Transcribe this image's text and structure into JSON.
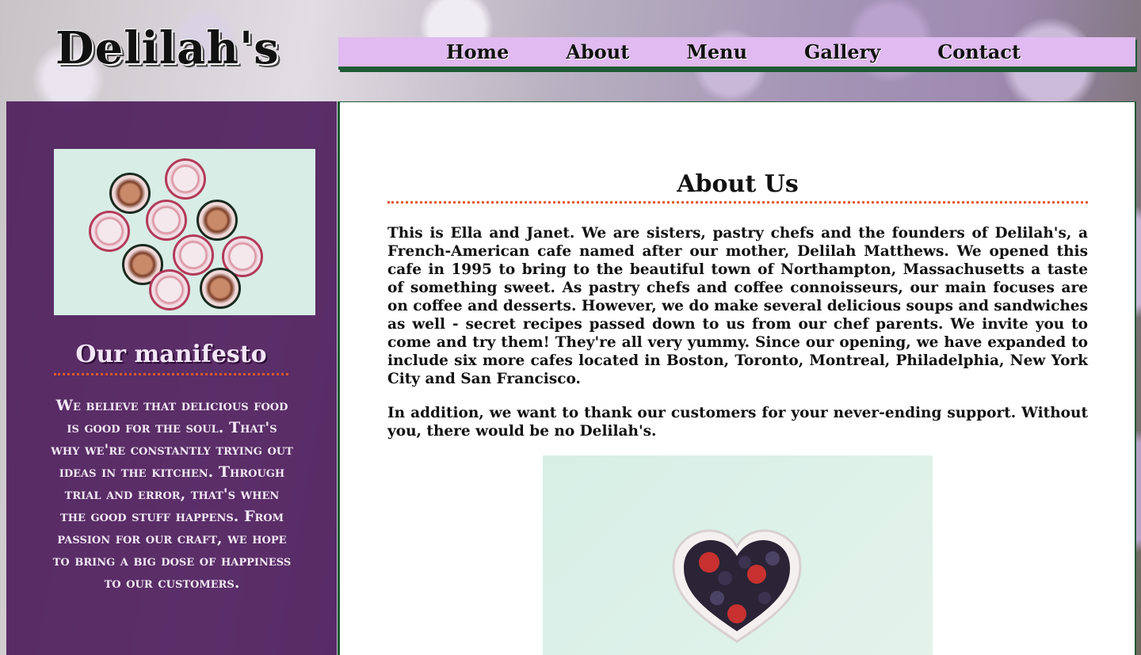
{
  "header": {
    "site_title": "Delilah's"
  },
  "nav": {
    "items": [
      {
        "label": "Home"
      },
      {
        "label": "About"
      },
      {
        "label": "Menu"
      },
      {
        "label": "Gallery"
      },
      {
        "label": "Contact"
      }
    ]
  },
  "sidebar": {
    "manifesto_title": "Our manifesto",
    "manifesto_text": "We believe that delicious food is good for the soul. That's why we're constantly trying out ideas in the kitchen. Through trial and error, that's when the good stuff happens. From passion for our craft, we hope to bring a big dose of happiness to our customers."
  },
  "main": {
    "title": "About Us",
    "paragraph_1": "This is Ella and Janet. We are sisters, pastry chefs and the founders of Delilah's, a French-American cafe named after our mother, Delilah Matthews. We opened this cafe in 1995 to bring to the beautiful town of Northampton, Massachusetts a taste of something sweet. As pastry chefs and coffee connoisseurs, our main focuses are on coffee and desserts. However, we do make several delicious soups and sandwiches as well - secret recipes passed down to us from our chef parents. We invite you to come and try them! They're all very yummy. Since our opening, we have expanded to include six more cafes located in Boston, Toronto, Montreal, Philadelphia, New York City and San Francisco.",
    "paragraph_2": "In addition, we want to thank our customers for your never-ending support. Without you, there would be no Delilah's."
  },
  "colors": {
    "nav_bg": "#e0baf0",
    "sidebar_bg": "#481656",
    "accent_border": "#1d5a35",
    "dotted_rule": "#e05a2a"
  }
}
